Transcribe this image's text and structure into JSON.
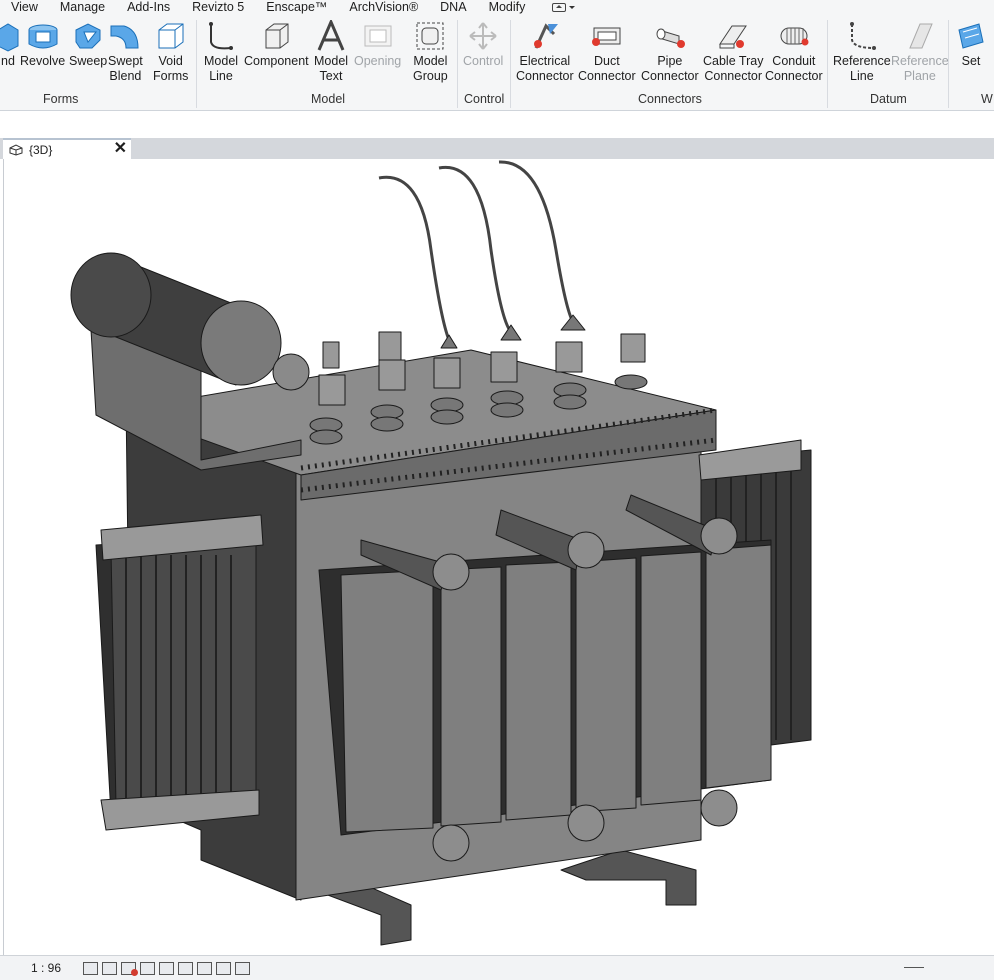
{
  "menu": [
    "View",
    "Manage",
    "Add-Ins",
    "Revizto 5",
    "Enscape™",
    "ArchVision®",
    "DNA",
    "Modify"
  ],
  "ribbon": {
    "forms": {
      "label": "Forms",
      "tools": [
        {
          "line1": "nd",
          "line2": ""
        },
        {
          "line1": "Revolve",
          "line2": ""
        },
        {
          "line1": "Sweep",
          "line2": ""
        },
        {
          "line1": "Swept",
          "line2": "Blend"
        },
        {
          "line1": "Void",
          "line2": "Forms"
        }
      ]
    },
    "model": {
      "label": "Model",
      "tools": [
        {
          "line1": "Model",
          "line2": "Line"
        },
        {
          "line1": "Component",
          "line2": ""
        },
        {
          "line1": "Model",
          "line2": "Text"
        },
        {
          "line1": "Opening",
          "line2": ""
        },
        {
          "line1": "Model",
          "line2": "Group"
        }
      ]
    },
    "control": {
      "label": "Control",
      "tools": [
        {
          "line1": "Control",
          "line2": ""
        }
      ]
    },
    "connectors": {
      "label": "Connectors",
      "tools": [
        {
          "line1": "Electrical",
          "line2": "Connector"
        },
        {
          "line1": "Duct",
          "line2": "Connector"
        },
        {
          "line1": "Pipe",
          "line2": "Connector"
        },
        {
          "line1": "Cable Tray",
          "line2": "Connector"
        },
        {
          "line1": "Conduit",
          "line2": "Connector"
        }
      ]
    },
    "datum": {
      "label": "Datum",
      "tools": [
        {
          "line1": "Reference",
          "line2": "Line"
        },
        {
          "line1": "Reference",
          "line2": "Plane"
        }
      ]
    },
    "work": {
      "label": "W",
      "tools": [
        {
          "line1": "Set",
          "line2": ""
        }
      ]
    }
  },
  "tab": {
    "name": "{3D}",
    "close": "✕"
  },
  "status": {
    "scale": "1 : 96"
  },
  "colors": {
    "ribbon_bg": "#f5f6f7",
    "accent_blue": "#1a7fd4",
    "connector_red": "#e03a2e",
    "model_gray": "#7d7d7d"
  }
}
